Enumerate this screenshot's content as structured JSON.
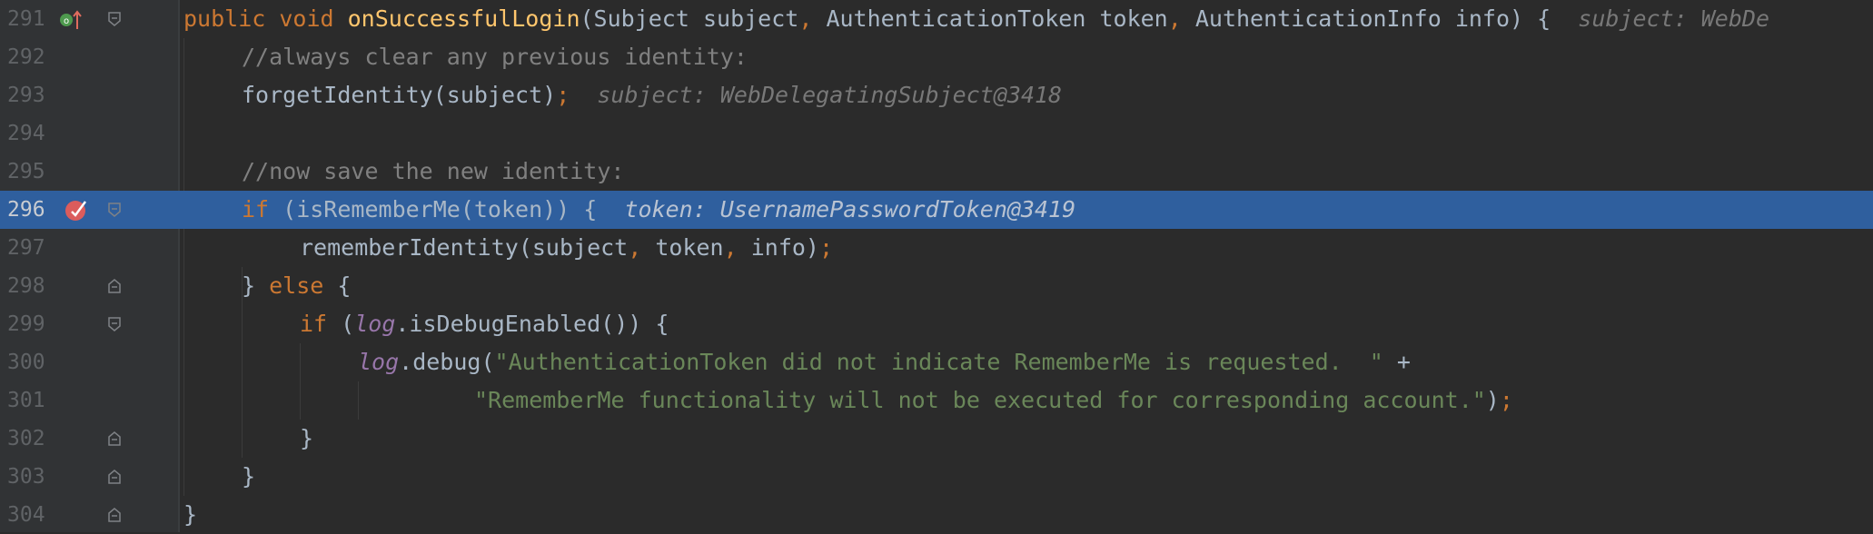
{
  "editor": {
    "lines": [
      {
        "num": "291",
        "tokens": [
          {
            "t": "public void ",
            "c": "kw"
          },
          {
            "t": "onSuccessfulLogin",
            "c": "fn"
          },
          {
            "t": "(Subject subject",
            "c": ""
          },
          {
            "t": ", ",
            "c": "kw"
          },
          {
            "t": "AuthenticationToken token",
            "c": ""
          },
          {
            "t": ", ",
            "c": "kw"
          },
          {
            "t": "AuthenticationInfo info) {",
            "c": ""
          },
          {
            "t": "  subject: WebDe",
            "c": "hint"
          }
        ]
      },
      {
        "num": "292",
        "tokens": [
          {
            "t": "//always clear any previous identity:",
            "c": "cmt"
          }
        ]
      },
      {
        "num": "293",
        "tokens": [
          {
            "t": "forgetIdentity(subject)",
            "c": ""
          },
          {
            "t": ";",
            "c": "kw"
          },
          {
            "t": "  subject: WebDelegatingSubject@3418",
            "c": "hint"
          }
        ]
      },
      {
        "num": "294",
        "tokens": []
      },
      {
        "num": "295",
        "tokens": [
          {
            "t": "//now save the new identity:",
            "c": "cmt"
          }
        ]
      },
      {
        "num": "296",
        "tokens": [
          {
            "t": "if ",
            "c": "kw"
          },
          {
            "t": "(isRememberMe(token)) {",
            "c": ""
          },
          {
            "t": "  token: UsernamePasswordToken@3419",
            "c": "hint"
          }
        ]
      },
      {
        "num": "297",
        "tokens": [
          {
            "t": "rememberIdentity(subject",
            "c": ""
          },
          {
            "t": ", ",
            "c": "kw"
          },
          {
            "t": "token",
            "c": ""
          },
          {
            "t": ", ",
            "c": "kw"
          },
          {
            "t": "info)",
            "c": ""
          },
          {
            "t": ";",
            "c": "kw"
          }
        ]
      },
      {
        "num": "298",
        "tokens": [
          {
            "t": "} ",
            "c": ""
          },
          {
            "t": "else ",
            "c": "kw"
          },
          {
            "t": "{",
            "c": ""
          }
        ]
      },
      {
        "num": "299",
        "tokens": [
          {
            "t": "if ",
            "c": "kw"
          },
          {
            "t": "(",
            "c": ""
          },
          {
            "t": "log",
            "c": "fld"
          },
          {
            "t": ".isDebugEnabled()) {",
            "c": ""
          }
        ]
      },
      {
        "num": "300",
        "tokens": [
          {
            "t": "log",
            "c": "fld"
          },
          {
            "t": ".debug(",
            "c": ""
          },
          {
            "t": "\"AuthenticationToken did not indicate RememberMe is requested.  \"",
            "c": "str"
          },
          {
            "t": " +",
            "c": ""
          }
        ]
      },
      {
        "num": "301",
        "tokens": [
          {
            "t": "\"RememberMe functionality will not be executed for corresponding account.\"",
            "c": "str"
          },
          {
            "t": ")",
            "c": ""
          },
          {
            "t": ";",
            "c": "kw"
          }
        ]
      },
      {
        "num": "302",
        "tokens": [
          {
            "t": "}",
            "c": ""
          }
        ]
      },
      {
        "num": "303",
        "tokens": [
          {
            "t": "}",
            "c": ""
          }
        ]
      },
      {
        "num": "304",
        "tokens": [
          {
            "t": "}",
            "c": ""
          }
        ]
      }
    ]
  },
  "icons": {
    "override_marker": "override-method-icon",
    "breakpoint": "breakpoint-icon",
    "fold": "fold-marker-icon"
  },
  "colors": {
    "background": "#2b2b2b",
    "gutter": "#313335",
    "current_line": "#2f5f9e",
    "keyword": "#cc7832",
    "method_decl": "#ffc66d",
    "string": "#6a8759",
    "comment": "#808080",
    "field": "#9876aa",
    "default_text": "#a9b7c6",
    "breakpoint": "#db5c5c"
  }
}
